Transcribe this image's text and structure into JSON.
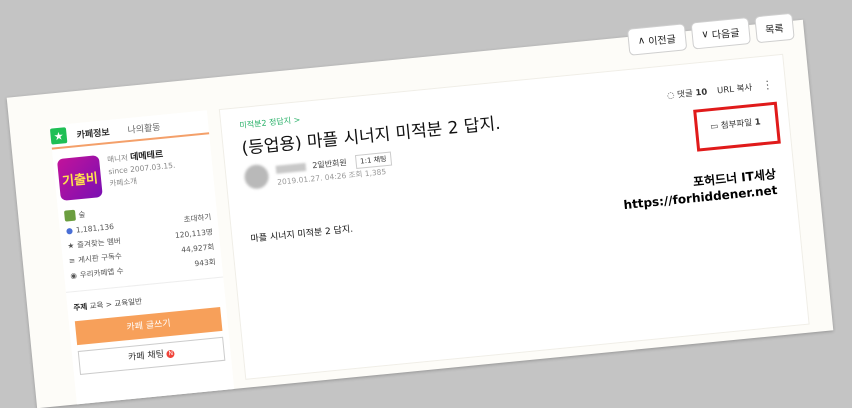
{
  "nav": {
    "prev_label": "이전글",
    "next_label": "다음글",
    "list_label": "목록"
  },
  "sidebar": {
    "tabs": [
      {
        "label": "카페정보"
      },
      {
        "label": "나의활동"
      }
    ],
    "cafe": {
      "logo_text": "기출비",
      "manager_label": "매니저",
      "manager_name": "데메테르",
      "since": "since 2007.03.15.",
      "intro": "카페소개"
    },
    "grade_label": "숲",
    "members_count": "1,181,136",
    "invite_label": "초대하기",
    "stats": [
      {
        "label": "즐겨찾는 멤버",
        "value": "120,113명"
      },
      {
        "label": "게시판 구독수",
        "value": "44,927회"
      },
      {
        "label": "우리카페앱 수",
        "value": "943회"
      }
    ],
    "topic_label": "주제",
    "topic_value": "교육 > 교육일반",
    "write_button": "카페 글쓰기",
    "chat_button": "카페 채팅",
    "chat_badge": "N"
  },
  "article": {
    "breadcrumb": "미적분2 정답지 >",
    "title": "(등업용) 마플 시너지 미적분 2 답지.",
    "comments_label": "댓글",
    "comments_count": "10",
    "url_copy": "URL 복사",
    "author_grade": "2일반회원",
    "chat_label": "1:1 채팅",
    "date": "2019.01.27. 04:26",
    "views": "조회 1,385",
    "attach_label": "첨부파일",
    "attach_count": "1",
    "body": "마플 시너지 미적분 2 답지."
  },
  "watermark": {
    "line1": "포허드너 IT세상",
    "line2": "https://forhiddener.net"
  }
}
